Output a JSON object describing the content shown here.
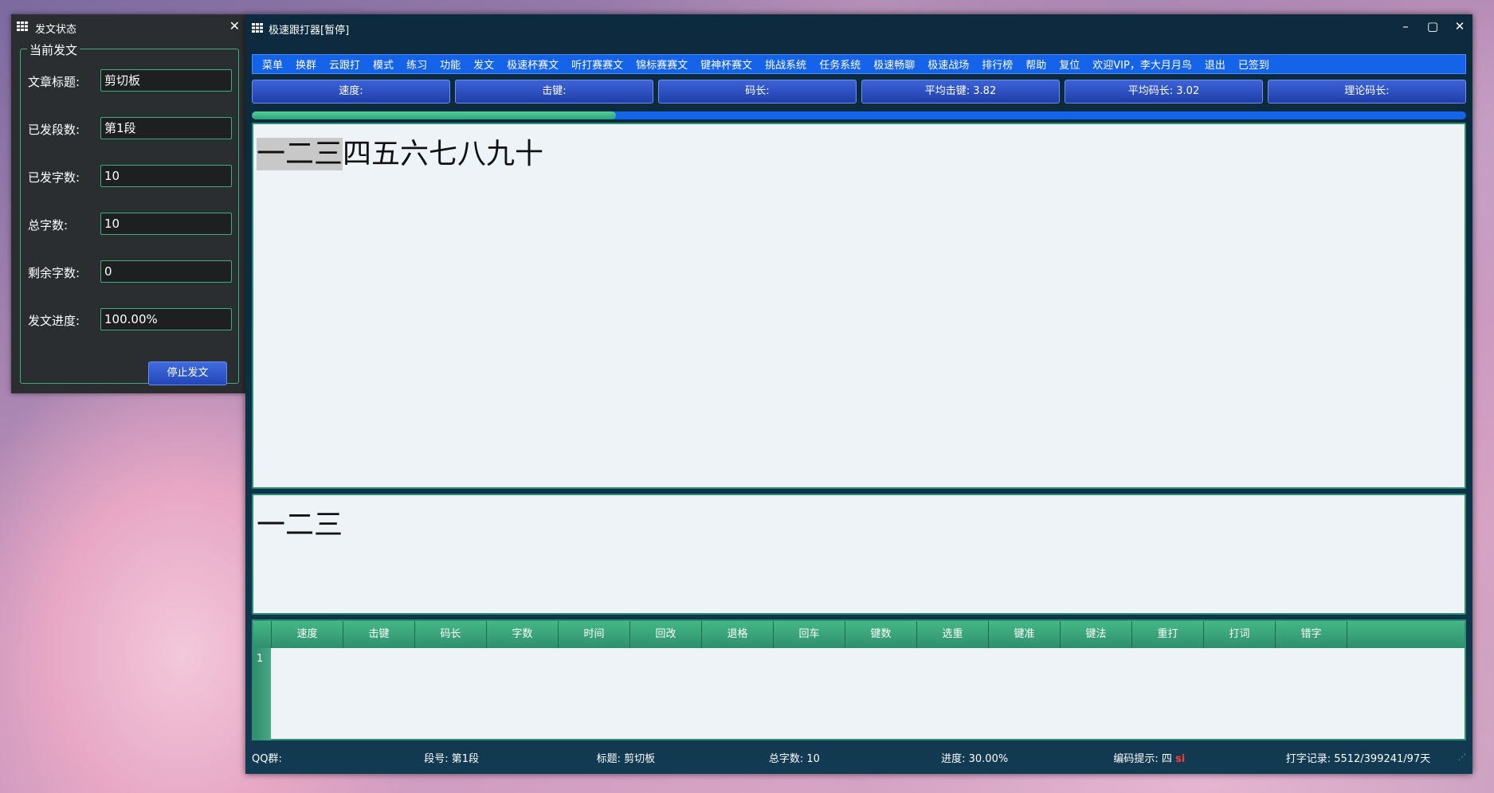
{
  "left_panel": {
    "title": "发文状态",
    "group_title": "当前发文",
    "fields": [
      {
        "label": "文章标题:",
        "value": "剪切板"
      },
      {
        "label": "已发段数:",
        "value": "第1段"
      },
      {
        "label": "已发字数:",
        "value": "10"
      },
      {
        "label": "总字数:",
        "value": "10"
      },
      {
        "label": "剩余字数:",
        "value": "0"
      },
      {
        "label": "发文进度:",
        "value": "100.00%"
      }
    ],
    "stop_button": "停止发文"
  },
  "main": {
    "title": "极速跟打器[暂停]",
    "menu": [
      "菜单",
      "换群",
      "云跟打",
      "模式",
      "练习",
      "功能",
      "发文",
      "极速杯赛文",
      "听打赛赛文",
      "锦标赛赛文",
      "键神杯赛文",
      "挑战系统",
      "任务系统",
      "极速畅聊",
      "极速战场",
      "排行榜",
      "帮助",
      "复位",
      "欢迎VIP，李大月月鸟",
      "退出",
      "已签到"
    ],
    "stats": [
      "速度:",
      "击键:",
      "码长:",
      "平均击键: 3.82",
      "平均码长: 3.02",
      "理论码长:"
    ],
    "progress": 0.3,
    "source_typed": "一二三",
    "source_rest": "四五六七八九十",
    "typed_text": "一二三",
    "table_columns": [
      "速度",
      "击键",
      "码长",
      "字数",
      "时间",
      "回改",
      "退格",
      "回车",
      "键数",
      "选重",
      "键准",
      "键法",
      "重打",
      "打词",
      "错字"
    ],
    "row_number": "1",
    "status": {
      "qq": "QQ群:",
      "segment": "段号: 第1段",
      "title": "标题: 剪切板",
      "total": "总字数: 10",
      "progress": "进度: 30.00%",
      "hint_label": "编码提示: 四",
      "hint_code": "si",
      "record": "打字记录: 5512/399241/97天"
    }
  },
  "colors": {
    "accent": "#1463e8",
    "green": "#2e8f6e",
    "panel_bg": "#2b2e31"
  }
}
